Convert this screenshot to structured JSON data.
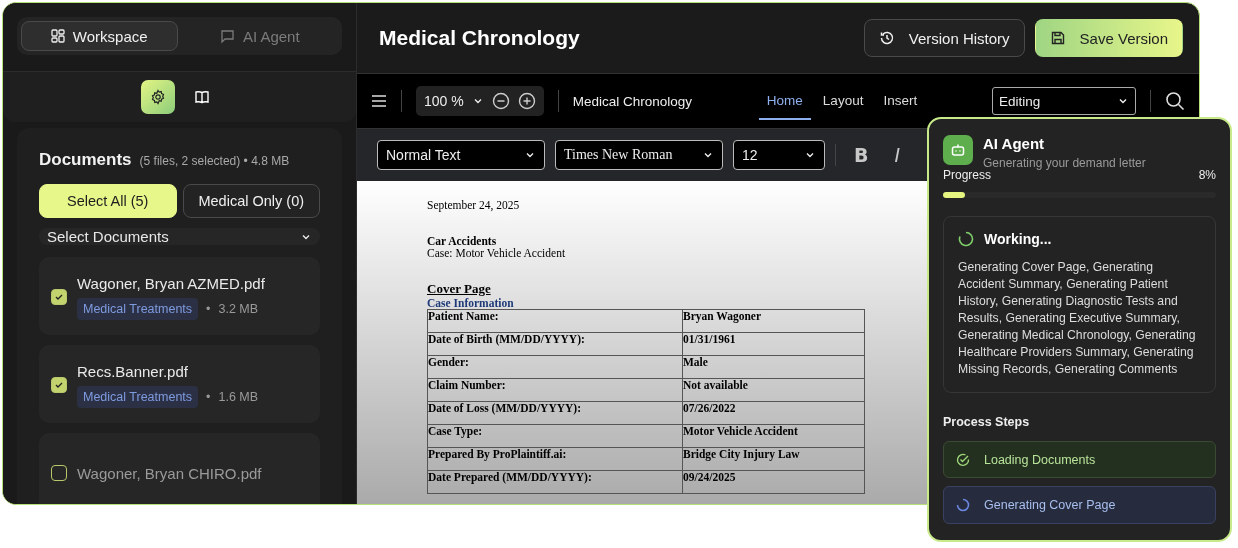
{
  "sidebar": {
    "tabs": [
      {
        "label": "Workspace",
        "kind": "grid",
        "selected": true
      },
      {
        "label": "AI Agent",
        "kind": "chat",
        "selected": false
      }
    ],
    "views": [
      {
        "kind": "settings",
        "selected": true
      },
      {
        "kind": "book",
        "selected": false
      }
    ],
    "documents": {
      "title": "Documents",
      "summary": "(5 files, 2 selected) • 4.8 MB",
      "buttons": [
        {
          "label": "Select All (5)",
          "selected": true
        },
        {
          "label": "Medical Only (0)",
          "selected": false
        }
      ],
      "dropdown": "Select Documents",
      "files": [
        {
          "name": "Wagoner, Bryan AZMED.pdf",
          "tag": "Medical Treatments",
          "separator": "•",
          "size": "3.2 MB",
          "checked": true
        },
        {
          "name": "Recs.Banner.pdf",
          "tag": "Medical Treatments",
          "separator": "•",
          "size": "1.6 MB",
          "checked": true
        },
        {
          "name": "Wagoner, Bryan CHIRO.pdf",
          "checked": false
        }
      ]
    }
  },
  "header": {
    "title": "Medical Chronology",
    "buttons": [
      {
        "label": "Version History",
        "kind": "history"
      },
      {
        "label": "Save Version",
        "kind": "save"
      }
    ]
  },
  "toolbar": {
    "zoom": "100 %",
    "doc_name": "Medical Chronology",
    "tabs": [
      {
        "label": "Home",
        "selected": true
      },
      {
        "label": "Layout",
        "selected": false
      },
      {
        "label": "Insert",
        "selected": false
      }
    ],
    "mode": "Editing"
  },
  "format": {
    "style": "Normal Text",
    "font": "Times New Roman",
    "size": "12",
    "buttons": [
      {
        "label": "B",
        "kind": "bold"
      },
      {
        "label": "I",
        "kind": "italic"
      }
    ]
  },
  "document": {
    "date": "September 24, 2025",
    "heading": "Car Accidents",
    "case": "Case: Motor Vehicle Accident",
    "section": "Cover Page",
    "subsection": "Case Information",
    "rows": [
      {
        "label": "Patient Name:",
        "value": "Bryan Wagoner"
      },
      {
        "label": "Date of Birth (MM/DD/YYYY):",
        "value": "01/31/1961"
      },
      {
        "label": "Gender:",
        "value": "Male"
      },
      {
        "label": "Claim Number:",
        "value": "Not available"
      },
      {
        "label": "Date of Loss (MM/DD/YYYY):",
        "value": "07/26/2022"
      },
      {
        "label": "Case Type:",
        "value": "Motor Vehicle Accident"
      },
      {
        "label": "Prepared By ProPlaintiff.ai:",
        "value": "Bridge City Injury Law"
      },
      {
        "label": "Date Prepared (MM/DD/YYYY):",
        "value": "09/24/2025"
      }
    ]
  },
  "agent": {
    "title": "AI Agent",
    "subtitle": "Generating your demand letter",
    "progress_label": "Progress",
    "progress_text": "8%",
    "level": 0.08,
    "status": "Working...",
    "details": "Generating Cover Page, Generating Accident Summary, Generating Patient History, Generating Diagnostic Tests and Results, Generating Executive Summary, Generating Medical Chronology, Generating Healthcare Providers Summary, Generating Missing Records, Generating Comments",
    "steps_title": "Process Steps",
    "steps": [
      {
        "label": "Loading Documents",
        "kind": "done"
      },
      {
        "label": "Generating Cover Page",
        "kind": "active"
      }
    ]
  }
}
